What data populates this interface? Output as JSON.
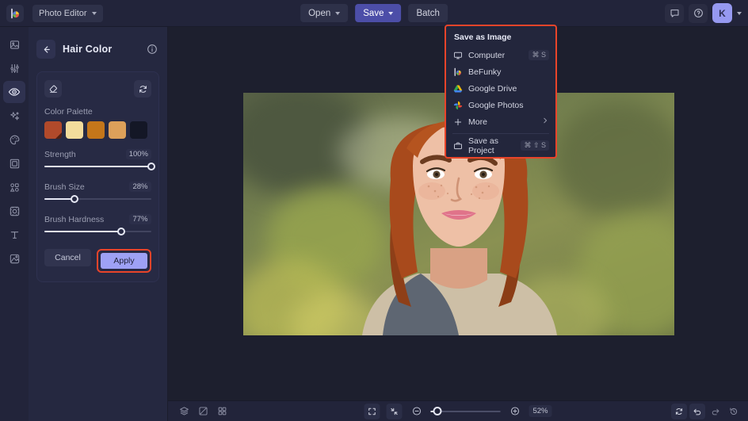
{
  "app": {
    "brand_icon": "befunky-logo-icon",
    "product": "Photo Editor",
    "accent": "#4c4ea8",
    "highlight": "#e8442a",
    "apply_color": "#9ea1f5"
  },
  "topbar": {
    "open_label": "Open",
    "save_label": "Save",
    "batch_label": "Batch",
    "feedback_icon": "chat-icon",
    "help_icon": "help-circle-icon",
    "avatar_initial": "K"
  },
  "rail": {
    "items": [
      {
        "icon": "image-edit-icon",
        "name": "edit",
        "active": false
      },
      {
        "icon": "sliders-icon",
        "name": "adjust",
        "active": false
      },
      {
        "icon": "eye-retouch-icon",
        "name": "retouch",
        "active": true
      },
      {
        "icon": "sparkles-icon",
        "name": "effects",
        "active": false
      },
      {
        "icon": "palette-icon",
        "name": "artsy",
        "active": false
      },
      {
        "icon": "frame-icon",
        "name": "frames",
        "active": false
      },
      {
        "icon": "shapes-icon",
        "name": "graphics",
        "active": false
      },
      {
        "icon": "texture-icon",
        "name": "textures",
        "active": false
      },
      {
        "icon": "text-icon",
        "name": "text",
        "active": false
      },
      {
        "icon": "overlay-icon",
        "name": "overlays",
        "active": false
      }
    ]
  },
  "panel": {
    "back_icon": "arrow-left-icon",
    "title": "Hair Color",
    "info_icon": "info-icon",
    "eraser_icon": "eraser-icon",
    "reset_icon": "reset-icon",
    "palette_label": "Color Palette",
    "swatches": [
      {
        "color": "#b14a2b",
        "selected": true
      },
      {
        "color": "#f2dc9c",
        "selected": false
      },
      {
        "color": "#c4761a",
        "selected": false
      },
      {
        "color": "#dda05a",
        "selected": false
      },
      {
        "color": "#141726",
        "selected": false
      }
    ],
    "sliders": [
      {
        "label": "Strength",
        "value": "100%",
        "pct": 100
      },
      {
        "label": "Brush Size",
        "value": "28%",
        "pct": 28
      },
      {
        "label": "Brush Hardness",
        "value": "77%",
        "pct": 77
      }
    ],
    "cancel_label": "Cancel",
    "apply_label": "Apply"
  },
  "save_menu": {
    "heading": "Save as Image",
    "items": [
      {
        "icon": "monitor-icon",
        "label": "Computer",
        "shortcut": "⌘ S"
      },
      {
        "icon": "befunky-icon",
        "label": "BeFunky",
        "shortcut": ""
      },
      {
        "icon": "google-drive-icon",
        "label": "Google Drive",
        "shortcut": ""
      },
      {
        "icon": "google-photos-icon",
        "label": "Google Photos",
        "shortcut": ""
      },
      {
        "icon": "plus-icon",
        "label": "More",
        "shortcut": "",
        "submenu": true
      }
    ],
    "project_item": {
      "icon": "briefcase-icon",
      "label": "Save as Project",
      "shortcut": "⌘ ⇧ S"
    }
  },
  "bottombar": {
    "layers_icon": "layers-icon",
    "compare_icon": "compare-icon",
    "grid_icon": "grid-icon",
    "fit_icon": "fit-screen-icon",
    "actual_icon": "actual-size-icon",
    "zoom_out_icon": "zoom-out-icon",
    "zoom_in_icon": "zoom-in-icon",
    "zoom_level": "52%",
    "refresh_icon": "refresh-icon",
    "undo_icon": "undo-icon",
    "redo_icon": "redo-icon",
    "history_icon": "history-icon"
  }
}
